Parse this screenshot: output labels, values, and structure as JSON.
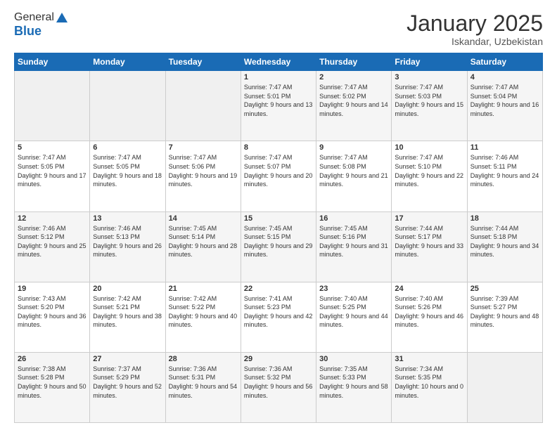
{
  "logo": {
    "line1": "General",
    "line2": "Blue"
  },
  "header": {
    "month": "January 2025",
    "location": "Iskandar, Uzbekistan"
  },
  "weekdays": [
    "Sunday",
    "Monday",
    "Tuesday",
    "Wednesday",
    "Thursday",
    "Friday",
    "Saturday"
  ],
  "weeks": [
    [
      {
        "day": "",
        "sunrise": "",
        "sunset": "",
        "daylight": ""
      },
      {
        "day": "",
        "sunrise": "",
        "sunset": "",
        "daylight": ""
      },
      {
        "day": "",
        "sunrise": "",
        "sunset": "",
        "daylight": ""
      },
      {
        "day": "1",
        "sunrise": "Sunrise: 7:47 AM",
        "sunset": "Sunset: 5:01 PM",
        "daylight": "Daylight: 9 hours and 13 minutes."
      },
      {
        "day": "2",
        "sunrise": "Sunrise: 7:47 AM",
        "sunset": "Sunset: 5:02 PM",
        "daylight": "Daylight: 9 hours and 14 minutes."
      },
      {
        "day": "3",
        "sunrise": "Sunrise: 7:47 AM",
        "sunset": "Sunset: 5:03 PM",
        "daylight": "Daylight: 9 hours and 15 minutes."
      },
      {
        "day": "4",
        "sunrise": "Sunrise: 7:47 AM",
        "sunset": "Sunset: 5:04 PM",
        "daylight": "Daylight: 9 hours and 16 minutes."
      }
    ],
    [
      {
        "day": "5",
        "sunrise": "Sunrise: 7:47 AM",
        "sunset": "Sunset: 5:05 PM",
        "daylight": "Daylight: 9 hours and 17 minutes."
      },
      {
        "day": "6",
        "sunrise": "Sunrise: 7:47 AM",
        "sunset": "Sunset: 5:05 PM",
        "daylight": "Daylight: 9 hours and 18 minutes."
      },
      {
        "day": "7",
        "sunrise": "Sunrise: 7:47 AM",
        "sunset": "Sunset: 5:06 PM",
        "daylight": "Daylight: 9 hours and 19 minutes."
      },
      {
        "day": "8",
        "sunrise": "Sunrise: 7:47 AM",
        "sunset": "Sunset: 5:07 PM",
        "daylight": "Daylight: 9 hours and 20 minutes."
      },
      {
        "day": "9",
        "sunrise": "Sunrise: 7:47 AM",
        "sunset": "Sunset: 5:08 PM",
        "daylight": "Daylight: 9 hours and 21 minutes."
      },
      {
        "day": "10",
        "sunrise": "Sunrise: 7:47 AM",
        "sunset": "Sunset: 5:10 PM",
        "daylight": "Daylight: 9 hours and 22 minutes."
      },
      {
        "day": "11",
        "sunrise": "Sunrise: 7:46 AM",
        "sunset": "Sunset: 5:11 PM",
        "daylight": "Daylight: 9 hours and 24 minutes."
      }
    ],
    [
      {
        "day": "12",
        "sunrise": "Sunrise: 7:46 AM",
        "sunset": "Sunset: 5:12 PM",
        "daylight": "Daylight: 9 hours and 25 minutes."
      },
      {
        "day": "13",
        "sunrise": "Sunrise: 7:46 AM",
        "sunset": "Sunset: 5:13 PM",
        "daylight": "Daylight: 9 hours and 26 minutes."
      },
      {
        "day": "14",
        "sunrise": "Sunrise: 7:45 AM",
        "sunset": "Sunset: 5:14 PM",
        "daylight": "Daylight: 9 hours and 28 minutes."
      },
      {
        "day": "15",
        "sunrise": "Sunrise: 7:45 AM",
        "sunset": "Sunset: 5:15 PM",
        "daylight": "Daylight: 9 hours and 29 minutes."
      },
      {
        "day": "16",
        "sunrise": "Sunrise: 7:45 AM",
        "sunset": "Sunset: 5:16 PM",
        "daylight": "Daylight: 9 hours and 31 minutes."
      },
      {
        "day": "17",
        "sunrise": "Sunrise: 7:44 AM",
        "sunset": "Sunset: 5:17 PM",
        "daylight": "Daylight: 9 hours and 33 minutes."
      },
      {
        "day": "18",
        "sunrise": "Sunrise: 7:44 AM",
        "sunset": "Sunset: 5:18 PM",
        "daylight": "Daylight: 9 hours and 34 minutes."
      }
    ],
    [
      {
        "day": "19",
        "sunrise": "Sunrise: 7:43 AM",
        "sunset": "Sunset: 5:20 PM",
        "daylight": "Daylight: 9 hours and 36 minutes."
      },
      {
        "day": "20",
        "sunrise": "Sunrise: 7:42 AM",
        "sunset": "Sunset: 5:21 PM",
        "daylight": "Daylight: 9 hours and 38 minutes."
      },
      {
        "day": "21",
        "sunrise": "Sunrise: 7:42 AM",
        "sunset": "Sunset: 5:22 PM",
        "daylight": "Daylight: 9 hours and 40 minutes."
      },
      {
        "day": "22",
        "sunrise": "Sunrise: 7:41 AM",
        "sunset": "Sunset: 5:23 PM",
        "daylight": "Daylight: 9 hours and 42 minutes."
      },
      {
        "day": "23",
        "sunrise": "Sunrise: 7:40 AM",
        "sunset": "Sunset: 5:25 PM",
        "daylight": "Daylight: 9 hours and 44 minutes."
      },
      {
        "day": "24",
        "sunrise": "Sunrise: 7:40 AM",
        "sunset": "Sunset: 5:26 PM",
        "daylight": "Daylight: 9 hours and 46 minutes."
      },
      {
        "day": "25",
        "sunrise": "Sunrise: 7:39 AM",
        "sunset": "Sunset: 5:27 PM",
        "daylight": "Daylight: 9 hours and 48 minutes."
      }
    ],
    [
      {
        "day": "26",
        "sunrise": "Sunrise: 7:38 AM",
        "sunset": "Sunset: 5:28 PM",
        "daylight": "Daylight: 9 hours and 50 minutes."
      },
      {
        "day": "27",
        "sunrise": "Sunrise: 7:37 AM",
        "sunset": "Sunset: 5:29 PM",
        "daylight": "Daylight: 9 hours and 52 minutes."
      },
      {
        "day": "28",
        "sunrise": "Sunrise: 7:36 AM",
        "sunset": "Sunset: 5:31 PM",
        "daylight": "Daylight: 9 hours and 54 minutes."
      },
      {
        "day": "29",
        "sunrise": "Sunrise: 7:36 AM",
        "sunset": "Sunset: 5:32 PM",
        "daylight": "Daylight: 9 hours and 56 minutes."
      },
      {
        "day": "30",
        "sunrise": "Sunrise: 7:35 AM",
        "sunset": "Sunset: 5:33 PM",
        "daylight": "Daylight: 9 hours and 58 minutes."
      },
      {
        "day": "31",
        "sunrise": "Sunrise: 7:34 AM",
        "sunset": "Sunset: 5:35 PM",
        "daylight": "Daylight: 10 hours and 0 minutes."
      },
      {
        "day": "",
        "sunrise": "",
        "sunset": "",
        "daylight": ""
      }
    ]
  ]
}
